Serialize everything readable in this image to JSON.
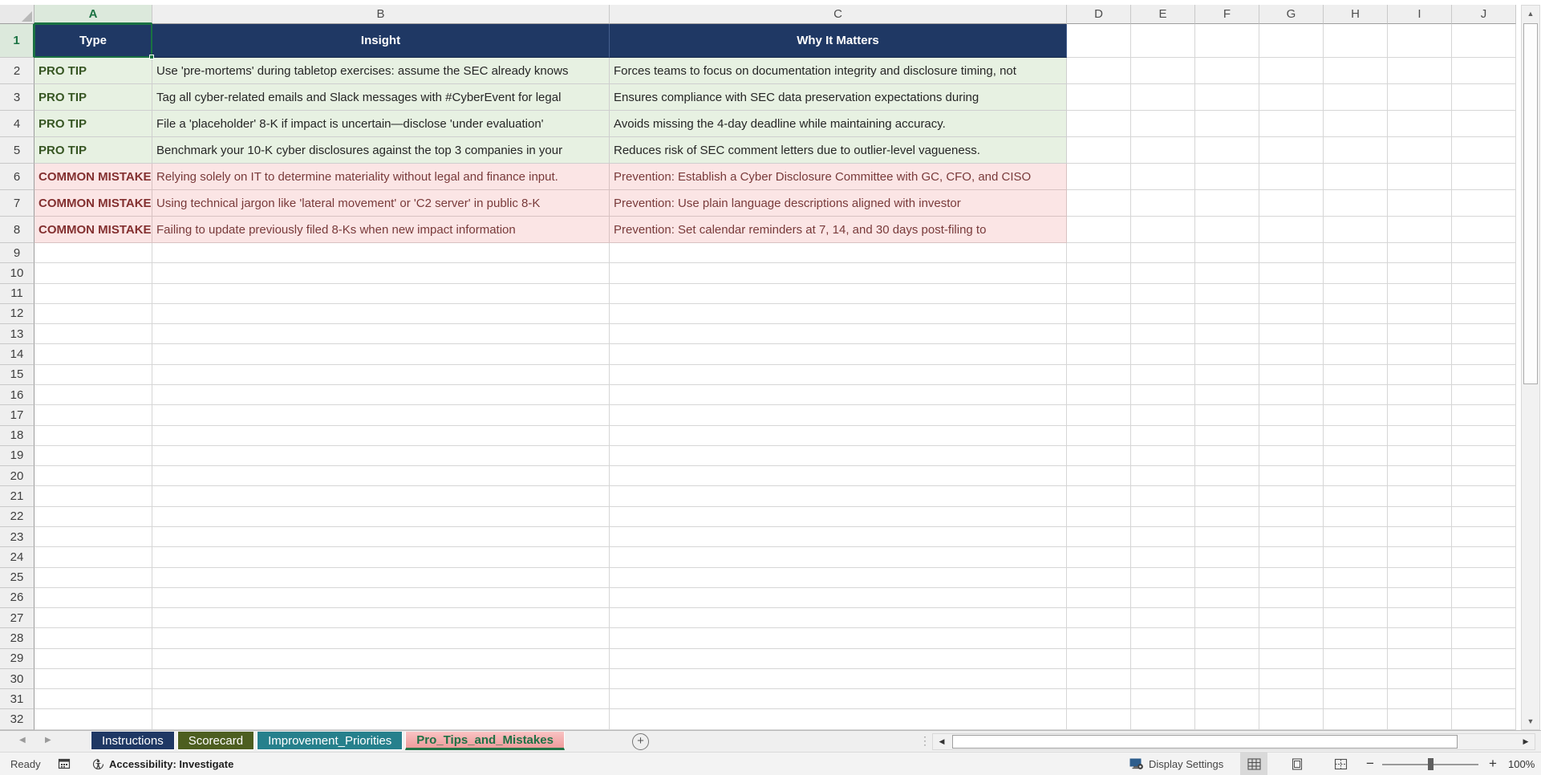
{
  "sheet": {
    "columns": [
      "A",
      "B",
      "C",
      "D",
      "E",
      "F",
      "G",
      "H",
      "I",
      "J"
    ],
    "row_count": 32,
    "selected_cell": "A1",
    "table": {
      "headers": [
        "Type",
        "Insight",
        "Why It Matters"
      ],
      "rows": [
        {
          "category": "protip",
          "type": "PRO TIP",
          "insight": "Use 'pre-mortems' during tabletop exercises: assume the SEC already knows",
          "why": "Forces teams to focus on documentation integrity and disclosure timing, not"
        },
        {
          "category": "protip",
          "type": "PRO TIP",
          "insight": "Tag all cyber-related emails and Slack messages with #CyberEvent for legal",
          "why": "Ensures compliance with SEC data preservation expectations during"
        },
        {
          "category": "protip",
          "type": "PRO TIP",
          "insight": "File a 'placeholder' 8-K if impact is uncertain—disclose 'under evaluation'",
          "why": "Avoids missing the 4-day deadline while maintaining accuracy."
        },
        {
          "category": "protip",
          "type": "PRO TIP",
          "insight": "Benchmark your 10-K cyber disclosures against the top 3 companies in your",
          "why": "Reduces risk of SEC comment letters due to outlier-level vagueness."
        },
        {
          "category": "mistake",
          "type": "COMMON MISTAKE",
          "insight": "Relying solely on IT to determine materiality without legal and finance input.",
          "why": "Prevention: Establish a Cyber Disclosure Committee with GC, CFO, and CISO"
        },
        {
          "category": "mistake",
          "type": "COMMON MISTAKE",
          "insight": "Using technical jargon like 'lateral movement' or 'C2 server' in public 8-K",
          "why": "Prevention: Use plain language descriptions aligned with investor"
        },
        {
          "category": "mistake",
          "type": "COMMON MISTAKE",
          "insight": "Failing to update previously filed 8-Ks when new impact information",
          "why": "Prevention: Set calendar reminders at 7, 14, and 30 days post-filing to"
        }
      ]
    }
  },
  "tab_bar": {
    "tabs": [
      {
        "label": "Instructions",
        "color": "#1F3864",
        "active": false
      },
      {
        "label": "Scorecard",
        "color": "#4D5E20",
        "active": false
      },
      {
        "label": "Improvement_Priorities",
        "color": "#26808C",
        "active": false
      },
      {
        "label": "Pro_Tips_and_Mistakes",
        "color": "#F2A5A5",
        "active": true
      }
    ]
  },
  "status_bar": {
    "ready_label": "Ready",
    "accessibility_label": "Accessibility: Investigate",
    "display_settings_label": "Display Settings",
    "zoom_level": "100%"
  },
  "icons": {
    "select_all": "select-all-triangle",
    "macro": "macro-record-icon",
    "accessibility": "accessibility-person-icon",
    "display_settings": "monitor-gear-icon",
    "views": [
      "normal-view-icon",
      "page-layout-icon",
      "page-break-preview-icon"
    ],
    "add_sheet": "plus-circle-icon"
  },
  "colors": {
    "header_fill": "#1F3864",
    "header_text": "#FFFFFF",
    "protip_fill": "#E7F1E2",
    "protip_text": "#375623",
    "mistake_fill": "#FBE5E5",
    "mistake_text": "#833030",
    "selection_green": "#1A7242",
    "active_tab_fill": "#F2A5A5",
    "active_tab_text": "#1E7145"
  }
}
